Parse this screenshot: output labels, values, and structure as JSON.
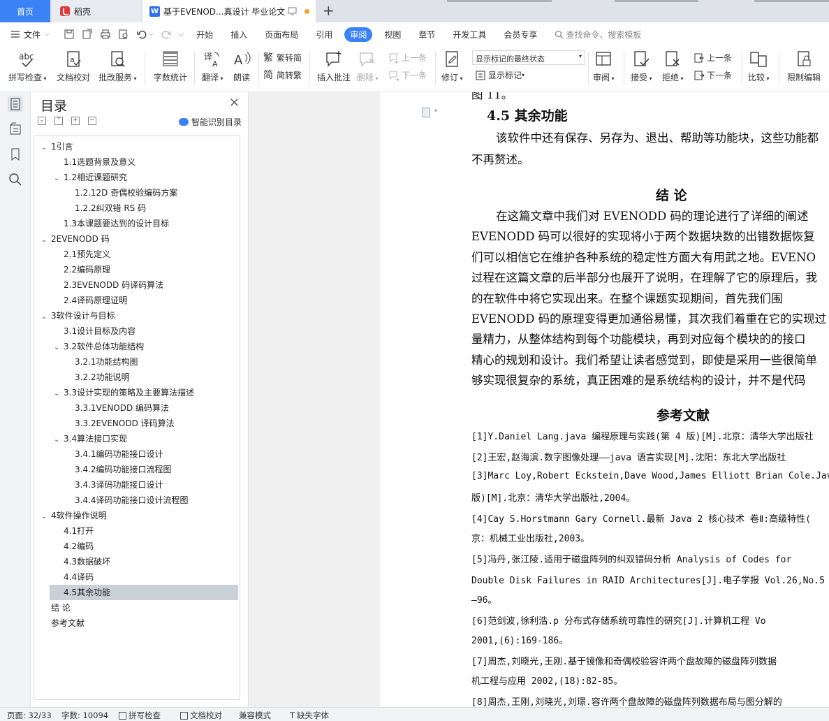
{
  "tabs": {
    "home": "首页",
    "daoke": "稻壳",
    "doc": "基于EVENOD...真设计 毕业论文",
    "new": "+"
  },
  "menu": {
    "file": "文件",
    "items": [
      "开始",
      "插入",
      "页面布局",
      "引用",
      "审阅",
      "视图",
      "章节",
      "开发工具",
      "会员专享"
    ],
    "active": "审阅",
    "search": "查找命令、搜索模板"
  },
  "ribbon": {
    "spell": "拼写检查",
    "doccheck": "文档校对",
    "review_service": "批改服务",
    "wordcount": "字数统计",
    "translate": "翻译",
    "read": "朗读",
    "to_trad": "繁转简",
    "to_simp": "简转繁",
    "insert_comment": "插入批注",
    "delete": "删除",
    "prev_comment": "上一条",
    "next_comment": "下一条",
    "revise": "修订",
    "markup_state": "显示标记的最终状态",
    "show_markup": "显示标记",
    "review_pane": "审阅",
    "accept": "接受",
    "reject": "拒绝",
    "prev_change": "上一条",
    "next_change": "下一条",
    "compare": "比较",
    "restrict": "限制编辑"
  },
  "toc": {
    "title": "目录",
    "smart": "智能识别目录",
    "items": [
      {
        "text": "1引言",
        "level": 0,
        "exp": "v"
      },
      {
        "text": "1.1选题背景及意义",
        "level": 1,
        "exp": ""
      },
      {
        "text": "1.2相近课题研究",
        "level": 1,
        "exp": "v"
      },
      {
        "text": "1.2.12D 奇偶校验编码方案",
        "level": 2,
        "exp": ""
      },
      {
        "text": "1.2.2纠双错 RS 码",
        "level": 2,
        "exp": ""
      },
      {
        "text": "1.3本课题要达到的设计目标",
        "level": 1,
        "exp": ""
      },
      {
        "text": "2EVENODD 码",
        "level": 0,
        "exp": "v"
      },
      {
        "text": "2.1预先定义",
        "level": 1,
        "exp": ""
      },
      {
        "text": "2.2编码原理",
        "level": 1,
        "exp": ""
      },
      {
        "text": "2.3EVENODD 码译码算法",
        "level": 1,
        "exp": ""
      },
      {
        "text": "2.4译码原理证明",
        "level": 1,
        "exp": ""
      },
      {
        "text": "3软件设计与目标",
        "level": 0,
        "exp": "v"
      },
      {
        "text": "3.1设计目标及内容",
        "level": 1,
        "exp": ""
      },
      {
        "text": "3.2软件总体功能结构",
        "level": 1,
        "exp": "v"
      },
      {
        "text": "3.2.1功能结构图",
        "level": 2,
        "exp": ""
      },
      {
        "text": "3.2.2功能说明",
        "level": 2,
        "exp": ""
      },
      {
        "text": "3.3设计实现的策略及主要算法描述",
        "level": 1,
        "exp": "v"
      },
      {
        "text": "3.3.1VENODD 编码算法",
        "level": 2,
        "exp": ""
      },
      {
        "text": "3.3.2EVENODD 译码算法",
        "level": 2,
        "exp": ""
      },
      {
        "text": "3.4算法接口实现",
        "level": 1,
        "exp": "v"
      },
      {
        "text": "3.4.1编码功能接口设计",
        "level": 2,
        "exp": ""
      },
      {
        "text": "3.4.2编码功能接口流程图",
        "level": 2,
        "exp": ""
      },
      {
        "text": "3.4.3译码功能接口设计",
        "level": 2,
        "exp": ""
      },
      {
        "text": "3.4.4译码功能接口设计流程图",
        "level": 2,
        "exp": ""
      },
      {
        "text": "4软件操作说明",
        "level": 0,
        "exp": "v"
      },
      {
        "text": "4.1打开",
        "level": 1,
        "exp": ""
      },
      {
        "text": "4.2编码",
        "level": 1,
        "exp": ""
      },
      {
        "text": "4.3数据破坏",
        "level": 1,
        "exp": ""
      },
      {
        "text": "4.4译码",
        "level": 1,
        "exp": ""
      },
      {
        "text": "4.5其余功能",
        "level": 1,
        "exp": "",
        "selected": true
      },
      {
        "text": "结    论",
        "level": 0,
        "exp": ""
      },
      {
        "text": "参考文献",
        "level": 0,
        "exp": ""
      }
    ]
  },
  "doc": {
    "top_fragment": "图 11。",
    "section_heading": "4.5  其余功能",
    "section_lines": [
      "该软件中还有保存、另存为、退出、帮助等功能块，这些功能都",
      "不再赘述。"
    ],
    "conclusion_heading": "结      论",
    "conclusion_lines": [
      "在这篇文章中我们对 EVENODD 码的理论进行了详细的阐述",
      "EVENODD 码可以很好的实现将小于两个数据块数的出错数据恢复",
      "们可以相信它在维护各种系统的稳定性方面大有用武之地。EVENO",
      "过程在这篇文章的后半部分也展开了说明，在理解了它的原理后，我",
      "的在软件中将它实现出来。在整个课题实现期间，首先我们围",
      "EVENODD 码的原理变得更加通俗易懂，其次我们着重在它的实现过",
      "量精力，从整体结构到每个功能模块，再到对应每个模块的的接口",
      "精心的规划和设计。我们希望让读者感觉到，即使是采用一些很简单",
      "够实现很复杂的系统，真正困难的是系统结构的设计，并不是代码"
    ],
    "refs_heading": "参考文献",
    "refs": [
      "[1]Y.Daniel Lang.java 编程原理与实践(第 4 版)[M].北京：清华大学出版社",
      "[2]王宏,赵海滨.数字图像处理——java 语言实现[M].沈阳：东北大学出版社",
      "[3]Marc Loy,Robert Eckstein,Dave Wood,James  Elliott  Brian Cole.Java",
      "版)[M].北京：清华大学出版社,2004。",
      "[4]Cay S.Horstmann Gary Cornell.最新 Java 2 核心技术 卷Ⅱ:高级特性(",
      "京：机械工业出版社,2003。",
      "[5]冯丹,张江陵.适用于磁盘阵列的纠双错码分析  Analysis of Codes for",
      "Double Disk Failures in RAID Architectures[J].电子学报 Vol.26,No.5",
      "—96。",
      "[6]范剑波,徐利浩.p 分布式存储系统可靠性的研究[J].计算机工程  Vo",
      "2001,(6):169-186。",
      "[7]周杰,刘晓光,王刚.基于镜像和奇偶校验容许两个盘故障的磁盘阵列数据",
      "机工程与应用 2002,(18):82-85。",
      "[8]周杰,王刚,刘晓光,刘璟.容许两个盘故障的磁盘阵列数据布局与图分解的"
    ]
  },
  "status": {
    "page": "页面: 32/33",
    "words": "字数: 10094",
    "spell": "拼写检查",
    "doccheck": "文档校对",
    "compat": "兼容模式",
    "missing_font": "缺失字体"
  }
}
